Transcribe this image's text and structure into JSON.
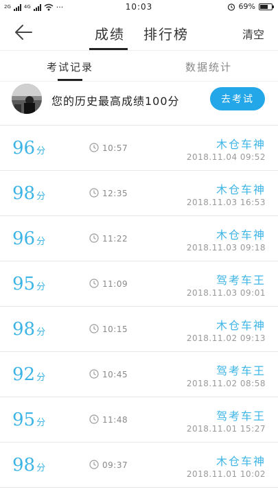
{
  "status_bar": {
    "network_left": "2G",
    "network_right": "4G",
    "dots": "···",
    "time": "10:03",
    "battery": "69%",
    "battery_level": 0.69
  },
  "nav": {
    "tab_scores": "成绩",
    "tab_ranking": "排行榜",
    "clear": "清空"
  },
  "subtabs": {
    "records": "考试记录",
    "stats": "数据统计"
  },
  "best": {
    "text": "您的历史最高成绩100分",
    "button": "去考试"
  },
  "score_unit": "分",
  "records": [
    {
      "score": "96",
      "duration": "10:57",
      "title": "木仓车神",
      "date": "2018.11.04  09:52"
    },
    {
      "score": "98",
      "duration": "12:35",
      "title": "木仓车神",
      "date": "2018.11.03  16:53"
    },
    {
      "score": "96",
      "duration": "11:22",
      "title": "木仓车神",
      "date": "2018.11.03  09:18"
    },
    {
      "score": "95",
      "duration": "11:09",
      "title": "驾考车王",
      "date": "2018.11.03  09:01"
    },
    {
      "score": "98",
      "duration": "10:15",
      "title": "木仓车神",
      "date": "2018.11.02  09:13"
    },
    {
      "score": "92",
      "duration": "10:45",
      "title": "驾考车王",
      "date": "2018.11.02  08:58"
    },
    {
      "score": "95",
      "duration": "11:48",
      "title": "驾考车王",
      "date": "2018.11.01  15:27"
    },
    {
      "score": "98",
      "duration": "09:37",
      "title": "木仓车神",
      "date": "2018.11.01  10:02"
    }
  ],
  "colors": {
    "accent": "#23a7e8",
    "score": "#3cb4e6"
  }
}
